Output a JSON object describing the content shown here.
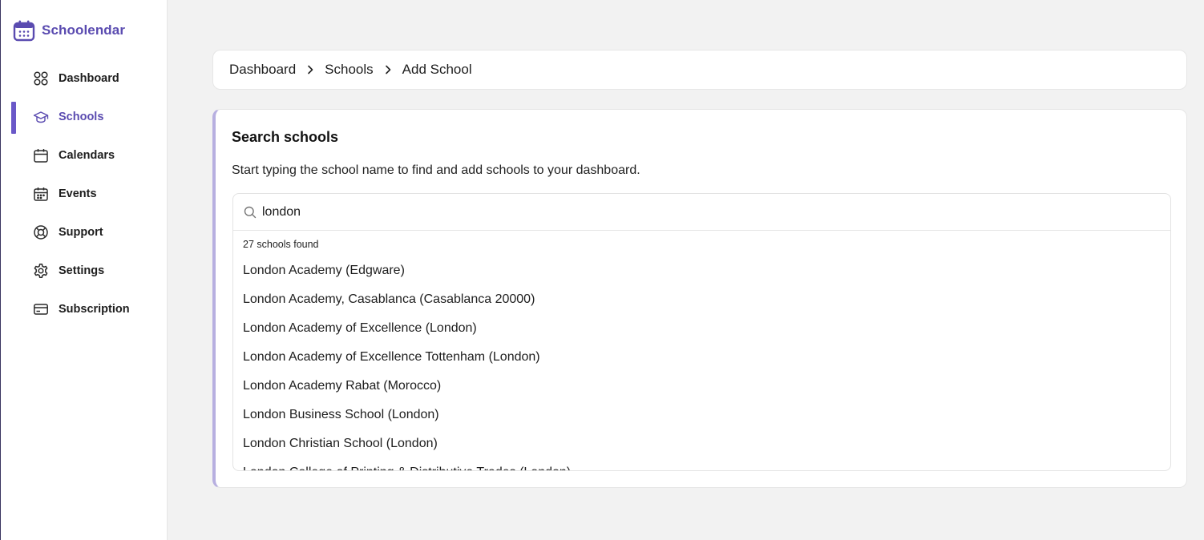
{
  "brand": {
    "name": "Schoolendar",
    "icon": "calendar-logo-icon",
    "color": "#5a4bb0"
  },
  "sidebar": {
    "items": [
      {
        "label": "Dashboard",
        "icon": "grid-icon",
        "active": false
      },
      {
        "label": "Schools",
        "icon": "graduation-cap-icon",
        "active": true
      },
      {
        "label": "Calendars",
        "icon": "calendar-icon",
        "active": false
      },
      {
        "label": "Events",
        "icon": "calendar-events-icon",
        "active": false
      },
      {
        "label": "Support",
        "icon": "lifebuoy-icon",
        "active": false
      },
      {
        "label": "Settings",
        "icon": "gear-icon",
        "active": false
      },
      {
        "label": "Subscription",
        "icon": "credit-card-icon",
        "active": false
      }
    ]
  },
  "breadcrumb": {
    "items": [
      "Dashboard",
      "Schools",
      "Add School"
    ],
    "separator_icon": "chevron-right-icon"
  },
  "main": {
    "title": "Search schools",
    "description": "Start typing the school name to find and add schools to your dashboard.",
    "search": {
      "value": "london",
      "icon": "search-icon",
      "results_count": "27 schools found",
      "results": [
        "London Academy (Edgware)",
        "London Academy, Casablanca (Casablanca 20000)",
        "London Academy of Excellence (London)",
        "London Academy of Excellence Tottenham (London)",
        "London Academy Rabat (Morocco)",
        "London Business School (London)",
        "London Christian School (London)",
        "London College of Printing & Distributive Trades (London)"
      ]
    }
  },
  "colors": {
    "accent": "#6a58c8",
    "card_border_accent": "#b7afe0",
    "background": "#f2f2f2"
  }
}
